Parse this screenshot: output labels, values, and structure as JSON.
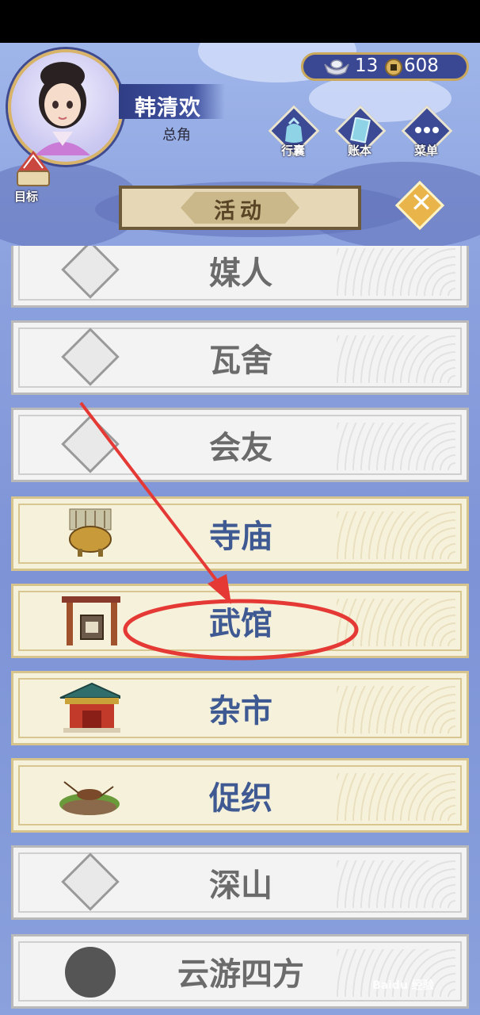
{
  "player": {
    "name": "韩清欢",
    "role": "总角"
  },
  "goal": {
    "label": "目标"
  },
  "currency": {
    "silver": "13",
    "coins": "608"
  },
  "header_buttons": [
    {
      "label": "行囊",
      "icon": "bag-icon"
    },
    {
      "label": "账本",
      "icon": "ledger-icon"
    },
    {
      "label": "菜单",
      "icon": "menu-icon"
    }
  ],
  "panel": {
    "title": "活动",
    "close_icon": "close-icon"
  },
  "activities": [
    {
      "label": "媒人",
      "state": "locked"
    },
    {
      "label": "瓦舍",
      "state": "locked"
    },
    {
      "label": "会友",
      "state": "locked"
    },
    {
      "label": "寺庙",
      "state": "unlocked"
    },
    {
      "label": "武馆",
      "state": "unlocked"
    },
    {
      "label": "杂市",
      "state": "unlocked"
    },
    {
      "label": "促织",
      "state": "unlocked"
    },
    {
      "label": "深山",
      "state": "locked"
    },
    {
      "label": "云游四方",
      "state": "locked"
    }
  ],
  "colors": {
    "accent": "#3f5a93",
    "highlight_annotation": "#e53935"
  },
  "watermark": "Baidu 经验"
}
